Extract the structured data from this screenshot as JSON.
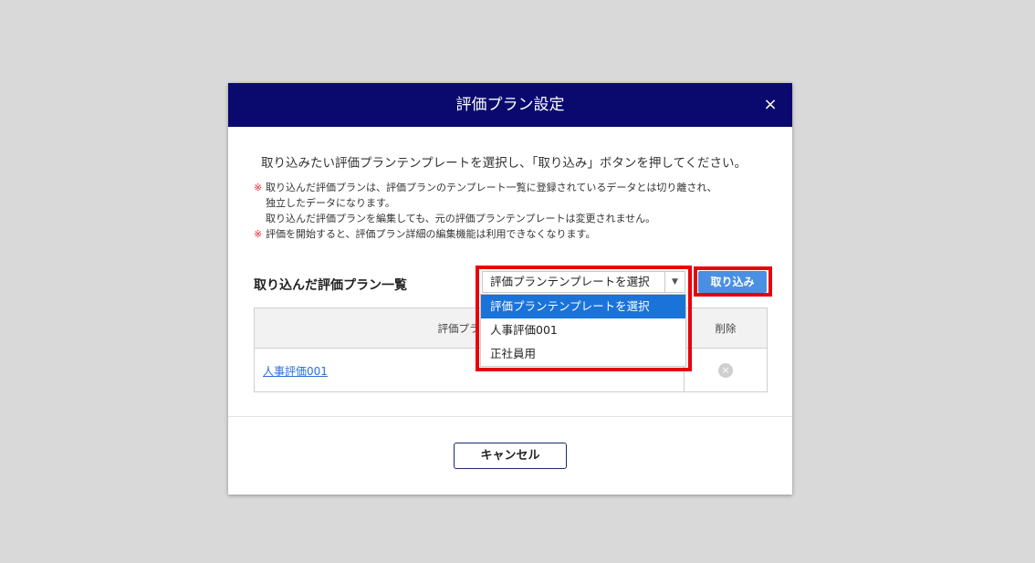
{
  "modal": {
    "title": "評価プラン設定",
    "close_label": "×"
  },
  "intro": "取り込みたい評価プランテンプレートを選択し、「取り込み」ボタンを押してください。",
  "notes": {
    "mark": "※",
    "line1": "取り込んだ評価プランは、評価プランのテンプレート一覧に登録されているデータとは切り離され、",
    "line2": "独立したデータになります。",
    "line3": "取り込んだ評価プランを編集しても、元の評価プランテンプレートは変更されません。",
    "line4": "評価を開始すると、評価プラン詳細の編集機能は利用できなくなります。"
  },
  "section_title": "取り込んだ評価プラン一覧",
  "template_select": {
    "value": "評価プランテンプレートを選択",
    "arrow": "▼",
    "options": [
      "評価プランテンプレートを選択",
      "人事評価001",
      "正社員用"
    ]
  },
  "import_button": "取り込み",
  "table": {
    "headers": {
      "name": "評価プラン名",
      "delete": "削除"
    },
    "rows": [
      {
        "name": "人事評価001",
        "delete_icon": "×"
      }
    ]
  },
  "cancel_button": "キャンセル",
  "colors": {
    "header_bg": "#0a0a6e",
    "accent_blue": "#4a90e2",
    "highlight_red": "#e8000b",
    "note_red": "#e8262a",
    "selected_option": "#1a73d9"
  }
}
